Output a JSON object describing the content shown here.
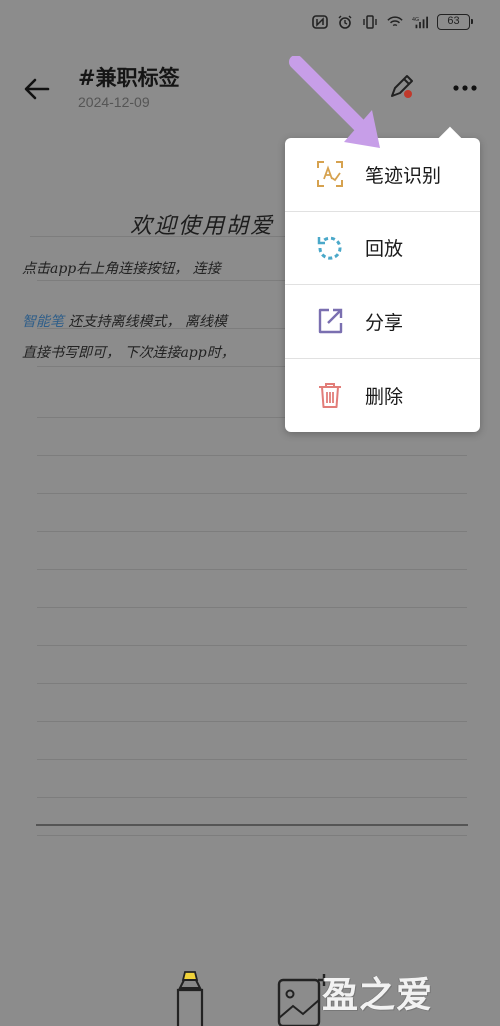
{
  "status_bar": {
    "battery": "63",
    "network": "4G"
  },
  "header": {
    "title": "#兼职标签",
    "date": "2024-12-09"
  },
  "note": {
    "heading": "欢迎使用胡爱",
    "line1": "点击app右上角连接按钮，  连接",
    "line2_blue": "智能笔",
    "line2_rest": " 还支持离线模式，  离线模",
    "line3": "直接书写即可，  下次连接app时，"
  },
  "menu": {
    "items": [
      {
        "label": "笔迹识别",
        "icon": "handwriting-recognition-icon"
      },
      {
        "label": "回放",
        "icon": "replay-icon"
      },
      {
        "label": "分享",
        "icon": "share-icon"
      },
      {
        "label": "删除",
        "icon": "trash-icon"
      }
    ]
  },
  "watermark": "盈之爱",
  "colors": {
    "overlay": "#8c8c8c",
    "menu_bg": "#ffffff",
    "arrow": "#c79ee8",
    "recognize_icon": "#d6a24f",
    "replay_icon": "#4aa8c9",
    "share_icon": "#7a6fb0",
    "delete_icon": "#e27d79"
  }
}
